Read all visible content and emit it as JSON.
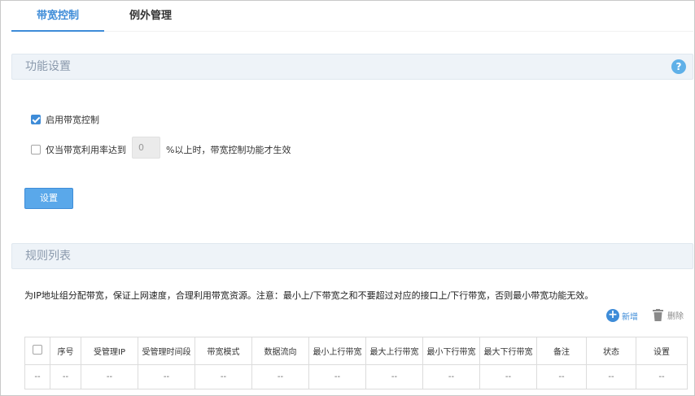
{
  "tabs": [
    {
      "label": "带宽控制",
      "active": true
    },
    {
      "label": "例外管理",
      "active": false
    }
  ],
  "function_settings": {
    "title": "功能设置",
    "help_icon": "?",
    "enable_checkbox": {
      "label": "启用带宽控制",
      "checked": true
    },
    "threshold_checkbox": {
      "label": "仅当带宽利用率达到",
      "checked": false
    },
    "threshold_value": "0",
    "threshold_suffix": "%以上时，带宽控制功能才生效",
    "set_button": "设置"
  },
  "rule_list": {
    "title": "规则列表",
    "note": "为IP地址组分配带宽，保证上网速度，合理利用带宽资源。注意：最小上/下带宽之和不要超过对应的接口上/下行带宽，否则最小带宽功能无效。",
    "add_label": "新增",
    "delete_label": "删除",
    "columns": [
      "序号",
      "受管理IP",
      "受管理时间段",
      "带宽模式",
      "数据流向",
      "最小上行带宽",
      "最大上行带宽",
      "最小下行带宽",
      "最大下行带宽",
      "备注",
      "状态",
      "设置"
    ],
    "empty_row": [
      "--",
      "--",
      "--",
      "--",
      "--",
      "--",
      "--",
      "--",
      "--",
      "--",
      "--",
      "--",
      "--"
    ]
  },
  "colors": {
    "accent": "#3e8cd8",
    "section_bg": "#eef3f8",
    "section_title": "#8b9aad",
    "help": "#5fb0e8",
    "button": "#5aa8ea"
  }
}
